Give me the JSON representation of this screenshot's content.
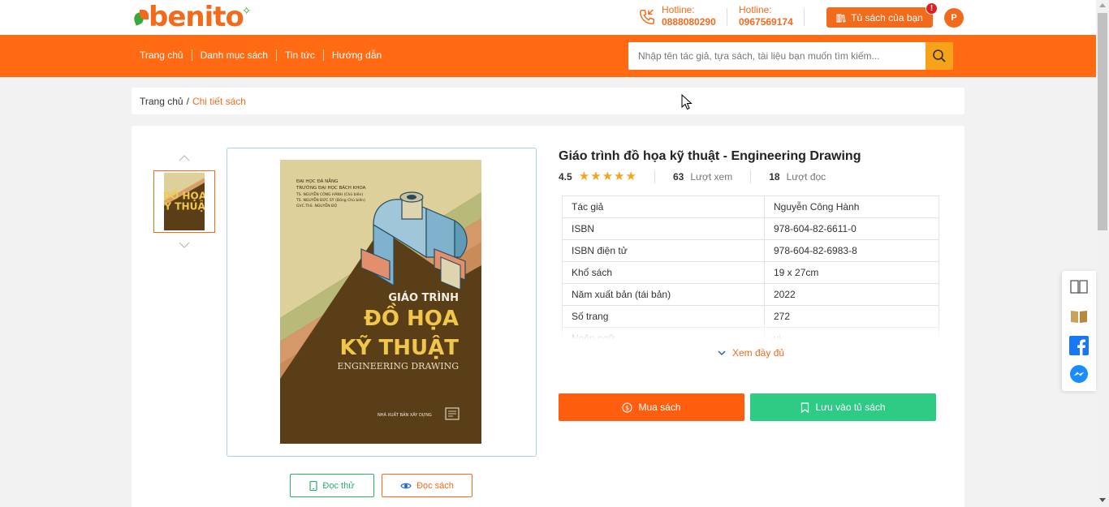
{
  "header": {
    "logo_text": "benito",
    "hotlines": [
      {
        "label": "Hotline:",
        "number": "0888080290"
      },
      {
        "label": "Hotline:",
        "number": "0967569174"
      }
    ],
    "shelf_button": "Tủ sách của bạn",
    "notification_badge": "!",
    "avatar_initial": "P"
  },
  "nav": {
    "items": [
      "Trang chủ",
      "Danh mục sách",
      "Tin tức",
      "Hướng dẫn"
    ],
    "search_placeholder": "Nhập tên tác giả, tựa sách, tài liệu bạn muốn tìm kiếm..."
  },
  "breadcrumb": {
    "home": "Trang chủ",
    "separator": "/",
    "current": "Chi tiết sách"
  },
  "book": {
    "title": "Giáo trình đồ họa kỹ thuật - Engineering Drawing",
    "rating": "4.5",
    "star_count": 5,
    "views_count": "63",
    "views_label": "Lượt xem",
    "reads_count": "18",
    "reads_label": "Lượt đọc",
    "info": [
      {
        "key": "Tác giả",
        "value": "Nguyễn Công Hành"
      },
      {
        "key": "ISBN",
        "value": "978-604-82-6611-0"
      },
      {
        "key": "ISBN điện tử",
        "value": "978-604-82-6983-8"
      },
      {
        "key": "Khổ sách",
        "value": "19 x 27cm"
      },
      {
        "key": "Năm xuất bản (tái bản)",
        "value": "2022"
      },
      {
        "key": "Số trang",
        "value": "272"
      },
      {
        "key": "Ngôn ngữ",
        "value": "vi"
      }
    ],
    "show_more": "Xem đầy đủ",
    "buy_button": "Mua sách",
    "save_button": "Lưu vào tủ sách",
    "preview_button": "Đọc thử",
    "read_button": "Đọc sách"
  },
  "cover": {
    "top_lines": [
      "ĐẠI HỌC ĐÀ NẴNG",
      "TRƯỜNG ĐẠI HỌC BÁCH KHOA",
      "TS. NGUYỄN CÔNG HÀNH (Chủ biên)",
      "TS. NGUYỄN ĐỨC SỸ (Đồng Chủ biên)",
      "GVC.ThS. NGUYỄN ĐỘ"
    ],
    "label": "GIÁO TRÌNH",
    "title_line1": "ĐỒ HỌA",
    "title_line2": "KỸ THUẬT",
    "subtitle": "ENGINEERING DRAWING",
    "publisher": "NHÀ XUẤT BẢN XÂY DỰNG"
  },
  "colors": {
    "brand_orange": "#ff6a13",
    "accent_yellow": "#f7a21b",
    "save_green": "#2ecb85"
  }
}
